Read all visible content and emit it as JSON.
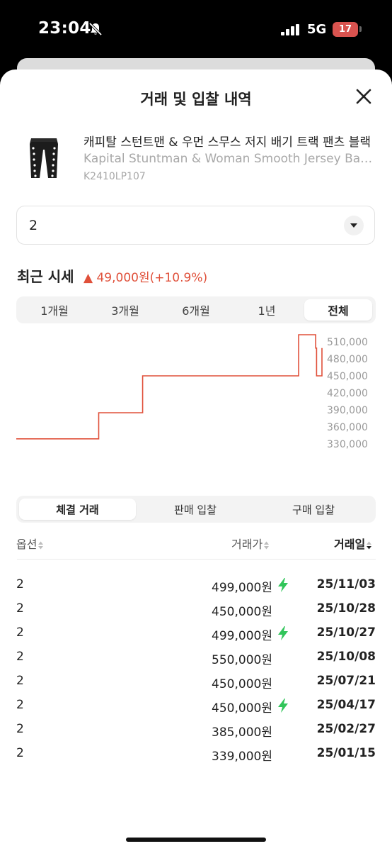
{
  "status_bar": {
    "time": "23:04",
    "network": "5G",
    "battery": "17"
  },
  "sheet": {
    "title": "거래 및 입찰 내역"
  },
  "product": {
    "name_ko": "캐피탈 스턴트맨 & 우먼 스무스 저지 배기 트랙 팬츠 블랙",
    "name_en": "Kapital Stuntman & Woman Smooth Jersey Baggy Track Pants Black",
    "code": "K2410LP107"
  },
  "option_select": {
    "value": "2"
  },
  "recent_price": {
    "title": "최근 시세",
    "change": "▲ 49,000원(+10.9%)",
    "change_color": "#e0503a"
  },
  "period_tabs": [
    {
      "label": "1개월",
      "active": false
    },
    {
      "label": "3개월",
      "active": false
    },
    {
      "label": "6개월",
      "active": false
    },
    {
      "label": "1년",
      "active": false
    },
    {
      "label": "전체",
      "active": true
    }
  ],
  "chart_data": {
    "type": "line",
    "y_ticks": [
      "510,000",
      "480,000",
      "450,000",
      "420,000",
      "390,000",
      "360,000",
      "330,000"
    ],
    "ylim": [
      330000,
      510000
    ],
    "series": [
      {
        "color": "#e0503a",
        "step": true,
        "x": [
          "2025-01-15",
          "2025-02-27",
          "2025-04-17",
          "2025-07-21",
          "2025-10-08",
          "2025-10-27",
          "2025-10-28",
          "2025-11-03"
        ],
        "values": [
          339000,
          385000,
          450000,
          450000,
          550000,
          499000,
          450000,
          499000
        ]
      }
    ]
  },
  "trade_tabs": [
    {
      "label": "체결 거래",
      "active": true
    },
    {
      "label": "판매 입찰",
      "active": false
    },
    {
      "label": "구매 입찰",
      "active": false
    }
  ],
  "table": {
    "headers": {
      "option": "옵션",
      "price": "거래가",
      "date": "거래일"
    },
    "rows": [
      {
        "option": "2",
        "price": "499,000원",
        "instant": true,
        "date": "25/11/03"
      },
      {
        "option": "2",
        "price": "450,000원",
        "instant": false,
        "date": "25/10/28"
      },
      {
        "option": "2",
        "price": "499,000원",
        "instant": true,
        "date": "25/10/27"
      },
      {
        "option": "2",
        "price": "550,000원",
        "instant": false,
        "date": "25/10/08"
      },
      {
        "option": "2",
        "price": "450,000원",
        "instant": false,
        "date": "25/07/21"
      },
      {
        "option": "2",
        "price": "450,000원",
        "instant": true,
        "date": "25/04/17"
      },
      {
        "option": "2",
        "price": "385,000원",
        "instant": false,
        "date": "25/02/27"
      },
      {
        "option": "2",
        "price": "339,000원",
        "instant": false,
        "date": "25/01/15"
      }
    ]
  },
  "icons": {
    "instant_bolt": "lightning-bolt-icon",
    "bolt_color": "#31c55a"
  }
}
